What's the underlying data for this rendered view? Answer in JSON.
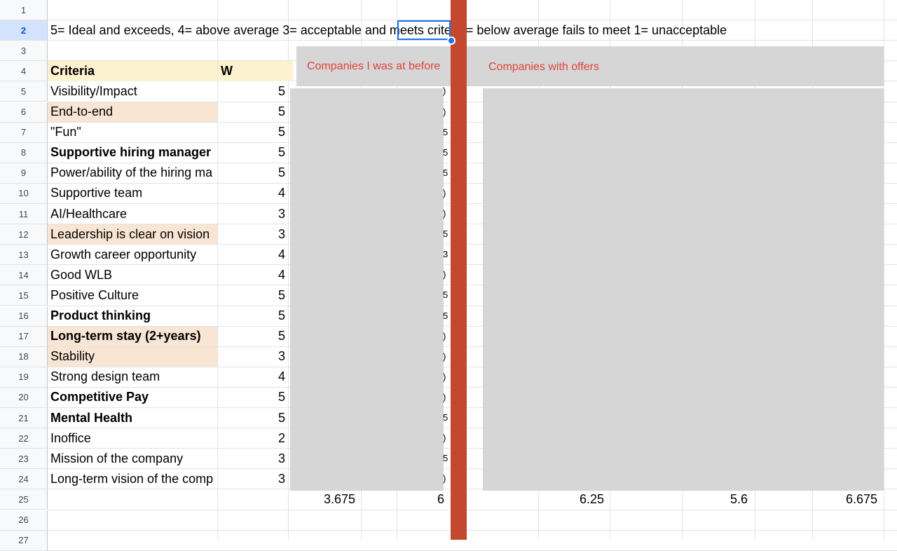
{
  "row_numbers": [
    "1",
    "2",
    "3",
    "4",
    "5",
    "6",
    "7",
    "8",
    "9",
    "10",
    "11",
    "12",
    "13",
    "14",
    "15",
    "16",
    "17",
    "18",
    "19",
    "20",
    "21",
    "22",
    "23",
    "24",
    "25",
    "26",
    "27"
  ],
  "legend_text": "5= Ideal and exceeds, 4= above average 3= acceptable and meets criter 2= below average fails to meet 1= unacceptable",
  "header": {
    "criteria": "Criteria",
    "weight": "W"
  },
  "overlay_labels": {
    "before": "Companies I was at before",
    "offers": "Companies with offers"
  },
  "rows": [
    {
      "criteria": "Visibility/Impact",
      "weight": "5"
    },
    {
      "criteria": "End-to-end",
      "weight": "5"
    },
    {
      "criteria": "\"Fun\"",
      "weight": "5"
    },
    {
      "criteria": "Supportive hiring manager",
      "weight": "5"
    },
    {
      "criteria": "Power/ability of the hiring ma",
      "weight": "5"
    },
    {
      "criteria": "Supportive team",
      "weight": "4"
    },
    {
      "criteria": "AI/Healthcare",
      "weight": "3"
    },
    {
      "criteria": "Leadership is clear on vision",
      "weight": "3"
    },
    {
      "criteria": "Growth career opportunity",
      "weight": "4"
    },
    {
      "criteria": "Good WLB",
      "weight": "4"
    },
    {
      "criteria": "Positive Culture",
      "weight": "5"
    },
    {
      "criteria": "Product thinking",
      "weight": "5"
    },
    {
      "criteria": "Long-term stay (2+years)",
      "weight": "5"
    },
    {
      "criteria": "Stability",
      "weight": "3"
    },
    {
      "criteria": "Strong design team",
      "weight": "4"
    },
    {
      "criteria": "Competitive Pay",
      "weight": "5"
    },
    {
      "criteria": "Mental Health",
      "weight": "5"
    },
    {
      "criteria": "Inoffice",
      "weight": "2"
    },
    {
      "criteria": "Mission of the company",
      "weight": "3"
    },
    {
      "criteria": "Long-term vision of the comp",
      "weight": "3"
    }
  ],
  "totals": [
    "3.675",
    "6",
    "6.25",
    "5.6",
    "6.675"
  ],
  "peek_chars": [
    ")",
    ")",
    "5",
    "5",
    "5",
    ")",
    ")",
    "5",
    "3",
    ")",
    "5",
    "5",
    ")",
    ")",
    ")",
    ")",
    "5",
    ")",
    "5",
    ")"
  ],
  "colors": {
    "redbar": "#c4482f",
    "overlay": "#d6d6d6",
    "label_red": "#e0433b",
    "peach": "#f8e5d3",
    "header_yellow": "#fdf2d0",
    "selection": "#1a73e8"
  }
}
